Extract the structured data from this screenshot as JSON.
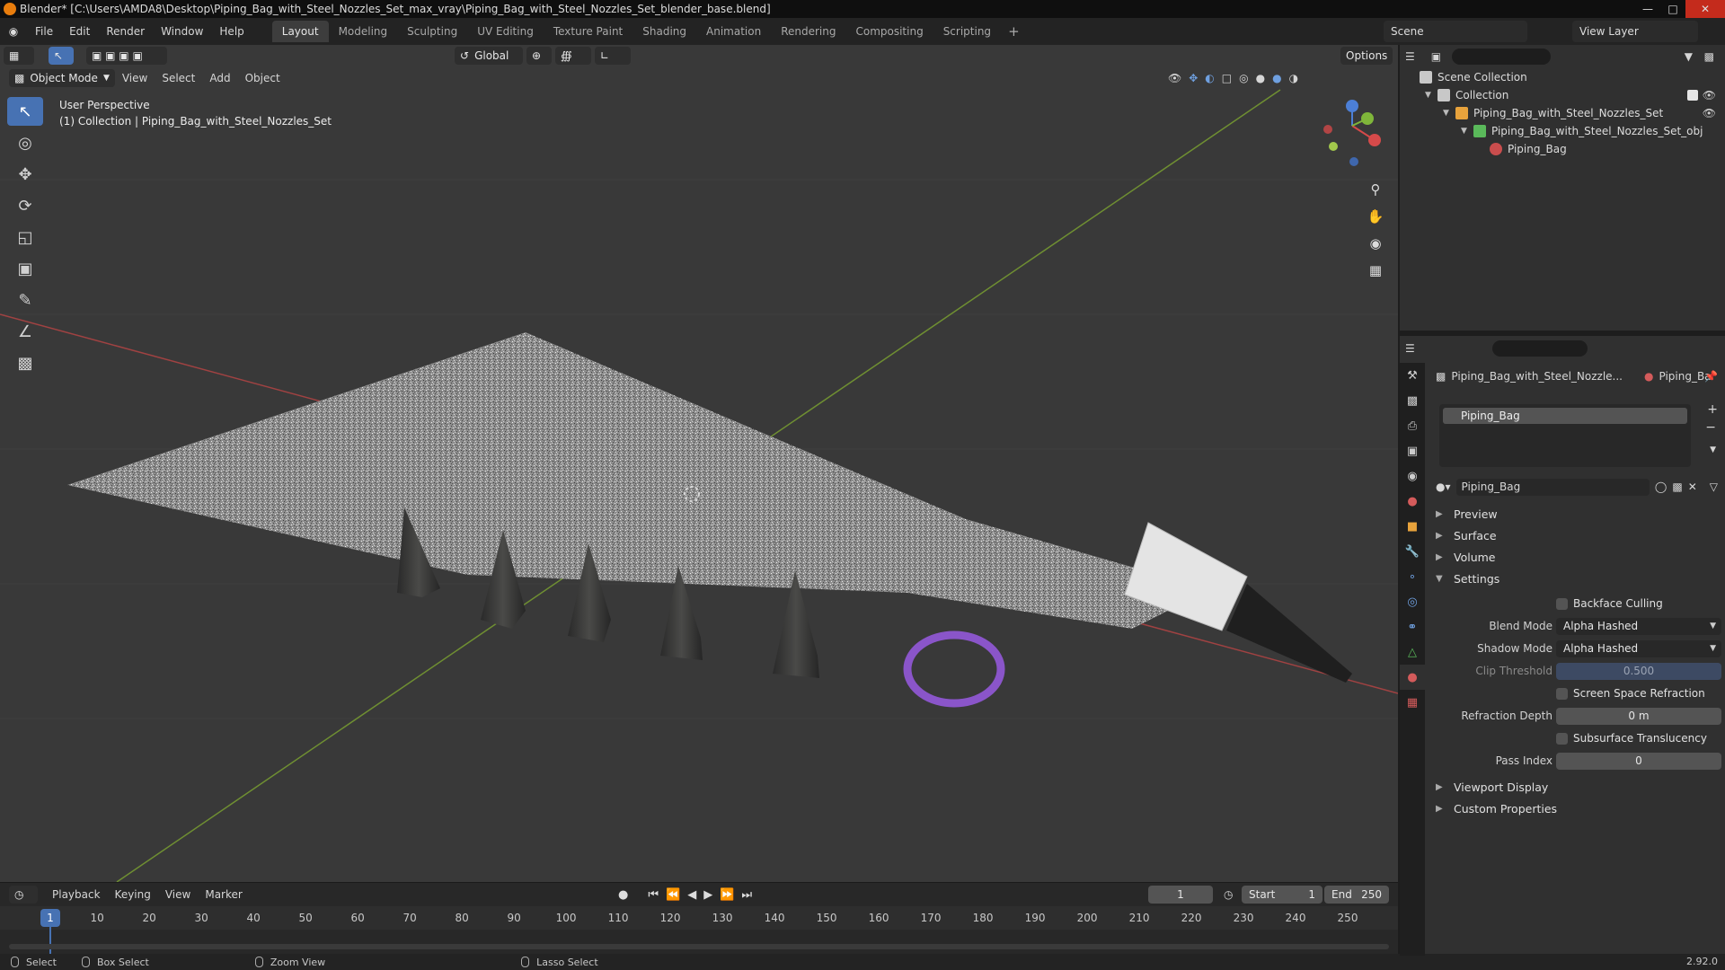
{
  "window": {
    "title": "Blender* [C:\\Users\\AMDA8\\Desktop\\Piping_Bag_with_Steel_Nozzles_Set_max_vray\\Piping_Bag_with_Steel_Nozzles_Set_blender_base.blend]"
  },
  "menubar": {
    "items": [
      "File",
      "Edit",
      "Render",
      "Window",
      "Help"
    ],
    "workspaces": [
      "Layout",
      "Modeling",
      "Sculpting",
      "UV Editing",
      "Texture Paint",
      "Shading",
      "Animation",
      "Rendering",
      "Compositing",
      "Scripting"
    ],
    "active_workspace": "Layout",
    "add_tab": "+",
    "scene": "Scene",
    "view_layer": "View Layer"
  },
  "viewport": {
    "mode": "Object Mode",
    "menus": [
      "View",
      "Select",
      "Add",
      "Object"
    ],
    "orientation": "Global",
    "options": "Options",
    "info_line1": "User Perspective",
    "info_line2": "(1) Collection | Piping_Bag_with_Steel_Nozzles_Set",
    "gizmo_axes": [
      "Z",
      "Y",
      "X"
    ],
    "tools": [
      "select-box",
      "cursor",
      "move",
      "rotate",
      "scale",
      "transform",
      "annotate",
      "measure",
      "add-cube"
    ],
    "nav_controls": [
      "zoom-icon",
      "hand-icon",
      "camera-icon",
      "grid-icon"
    ]
  },
  "outliner": {
    "rows": [
      {
        "label": "Scene Collection",
        "indent": 0,
        "icon": "collection"
      },
      {
        "label": "Collection",
        "indent": 1,
        "icon": "collection"
      },
      {
        "label": "Piping_Bag_with_Steel_Nozzles_Set",
        "indent": 2,
        "icon": "object"
      },
      {
        "label": "Piping_Bag_with_Steel_Nozzles_Set_obj",
        "indent": 3,
        "icon": "mesh"
      },
      {
        "label": "Piping_Bag",
        "indent": 4,
        "icon": "material"
      }
    ]
  },
  "properties": {
    "object_name": "Piping_Bag_with_Steel_Nozzle...",
    "material_short": "Piping_Ba",
    "slot": "Piping_Bag",
    "material": "Piping_Bag",
    "panels": {
      "preview": "Preview",
      "surface": "Surface",
      "volume": "Volume",
      "settings": "Settings",
      "viewport_display": "Viewport Display",
      "custom_properties": "Custom Properties"
    },
    "settings": {
      "backface_culling": "Backface Culling",
      "blend_mode_label": "Blend Mode",
      "blend_mode": "Alpha Hashed",
      "shadow_mode_label": "Shadow Mode",
      "shadow_mode": "Alpha Hashed",
      "clip_threshold_label": "Clip Threshold",
      "clip_threshold": "0.500",
      "ssr_label": "Screen Space Refraction",
      "refraction_depth_label": "Refraction Depth",
      "refraction_depth": "0 m",
      "subsurface_label": "Subsurface Translucency",
      "pass_index_label": "Pass Index",
      "pass_index": "0"
    }
  },
  "timeline": {
    "menus": [
      "Playback",
      "Keying",
      "View",
      "Marker"
    ],
    "current_frame": "1",
    "start_label": "Start",
    "start": "1",
    "end_label": "End",
    "end": "250",
    "ticks": [
      "1",
      "10",
      "20",
      "30",
      "40",
      "50",
      "60",
      "70",
      "80",
      "90",
      "100",
      "110",
      "120",
      "130",
      "140",
      "150",
      "160",
      "170",
      "180",
      "190",
      "200",
      "210",
      "220",
      "230",
      "240",
      "250"
    ]
  },
  "statusbar": {
    "select": "Select",
    "box_select": "Box Select",
    "zoom_view": "Zoom View",
    "lasso_select": "Lasso Select",
    "version": "2.92.0"
  },
  "colors": {
    "accent": "#4772b3",
    "viewport_bg": "#393939",
    "x_axis": "#c84a4a",
    "y_axis": "#7fa33a",
    "ring": "#8a55c9"
  }
}
